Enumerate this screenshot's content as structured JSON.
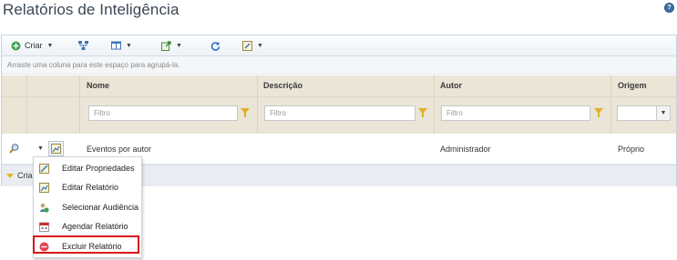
{
  "page": {
    "title": "Relatórios de Inteligência",
    "help_glyph": "?"
  },
  "toolbar": {
    "create_label": "Criar",
    "icons": [
      "add-icon",
      "hierarchy-icon",
      "columns-icon",
      "export-icon",
      "refresh-icon",
      "edit-icon"
    ]
  },
  "grid": {
    "group_hint": "Arraste uma coluna para este espaço para agrupá-la.",
    "columns": [
      "Nome",
      "Descrição",
      "Autor",
      "Origem"
    ],
    "filter_placeholder": "Filtro",
    "rows": [
      {
        "nome": "Eventos por autor",
        "descricao": "",
        "autor": "Administrador",
        "origem": "Próprio"
      }
    ],
    "footer_label": "Cria"
  },
  "context_menu": {
    "items": [
      {
        "label": "Editar Propriedades",
        "icon": "edit-properties-icon"
      },
      {
        "label": "Editar Relatório",
        "icon": "edit-report-icon"
      },
      {
        "label": "Selecionar Audiência",
        "icon": "audience-icon"
      },
      {
        "label": "Agendar Relatório",
        "icon": "calendar-icon"
      },
      {
        "label": "Excluir Relatório",
        "icon": "delete-icon",
        "highlighted": true
      }
    ]
  },
  "colors": {
    "accent": "#3a4654",
    "header_bg": "#eae5d6",
    "highlight": "#d9141b",
    "filter_icon": "#e0b124"
  }
}
